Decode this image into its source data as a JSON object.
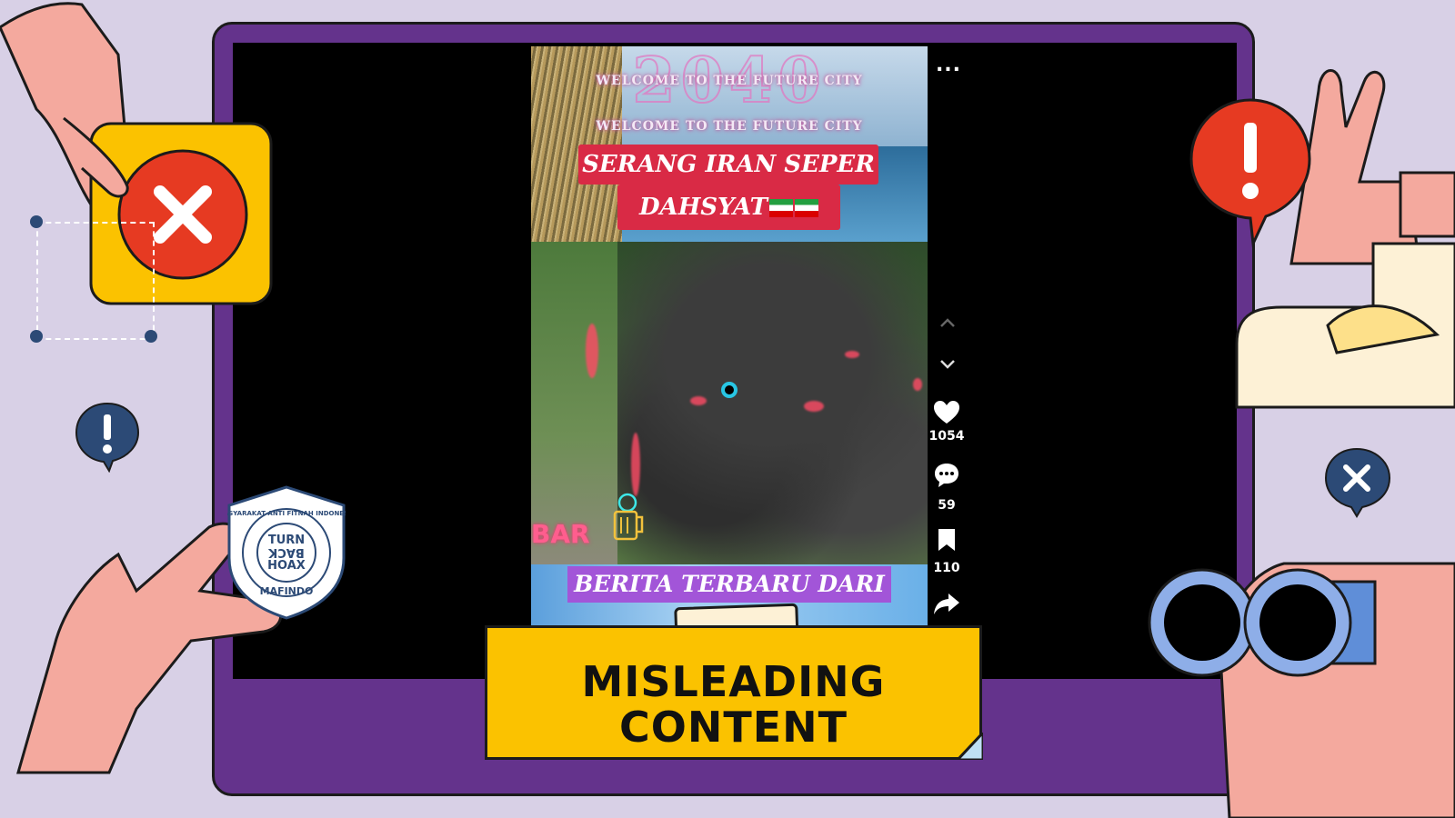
{
  "video": {
    "top_text_lines": [
      "WELCOME TO THE FUTURE CITY",
      "WELCOME TO THE FUTURE CITY"
    ],
    "year_text": "2040",
    "headline_line1": "SERANG IRAN SEPER",
    "headline_line2": "DAHSYAT",
    "bar_sign": "BAR",
    "bottom_banner": "BERITA TERBARU DARI"
  },
  "rail": {
    "more_label": "...",
    "likes": "1054",
    "comments": "59",
    "saves": "110"
  },
  "verdict": {
    "line1": "MISLEADING",
    "line2": "CONTENT"
  },
  "badge": {
    "ring_text": "MASYARAKAT ANTI FITNAH INDONESIA",
    "center_lines": [
      "TURN",
      "BACK",
      "HOAX"
    ],
    "bottom_text": "MAFINDO"
  },
  "colors": {
    "background": "#d8d0e6",
    "frame": "#64338c",
    "label": "#fbc200",
    "alert_red": "#e63a22",
    "badge_blue": "#2c4a76"
  }
}
